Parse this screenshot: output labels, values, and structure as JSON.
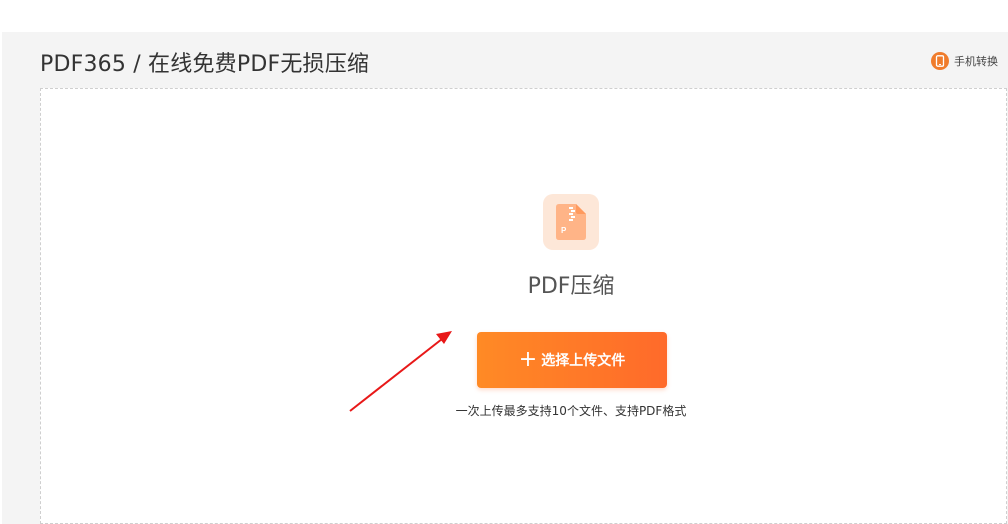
{
  "header": {
    "title": "PDF365 / 在线免费PDF无损压缩",
    "mobile_link_label": "手机转换",
    "mobile_icon": "phone-icon"
  },
  "tool": {
    "icon": "pdf-zip-file-icon",
    "icon_letter": "P",
    "title": "PDF压缩",
    "upload_button_label": "选择上传文件",
    "plus_icon": "+",
    "hint": "一次上传最多支持10个文件、支持PDF格式"
  },
  "colors": {
    "accent": "#ff7a28",
    "accent_light": "#fde7d8",
    "annotation_arrow": "#e81818"
  }
}
